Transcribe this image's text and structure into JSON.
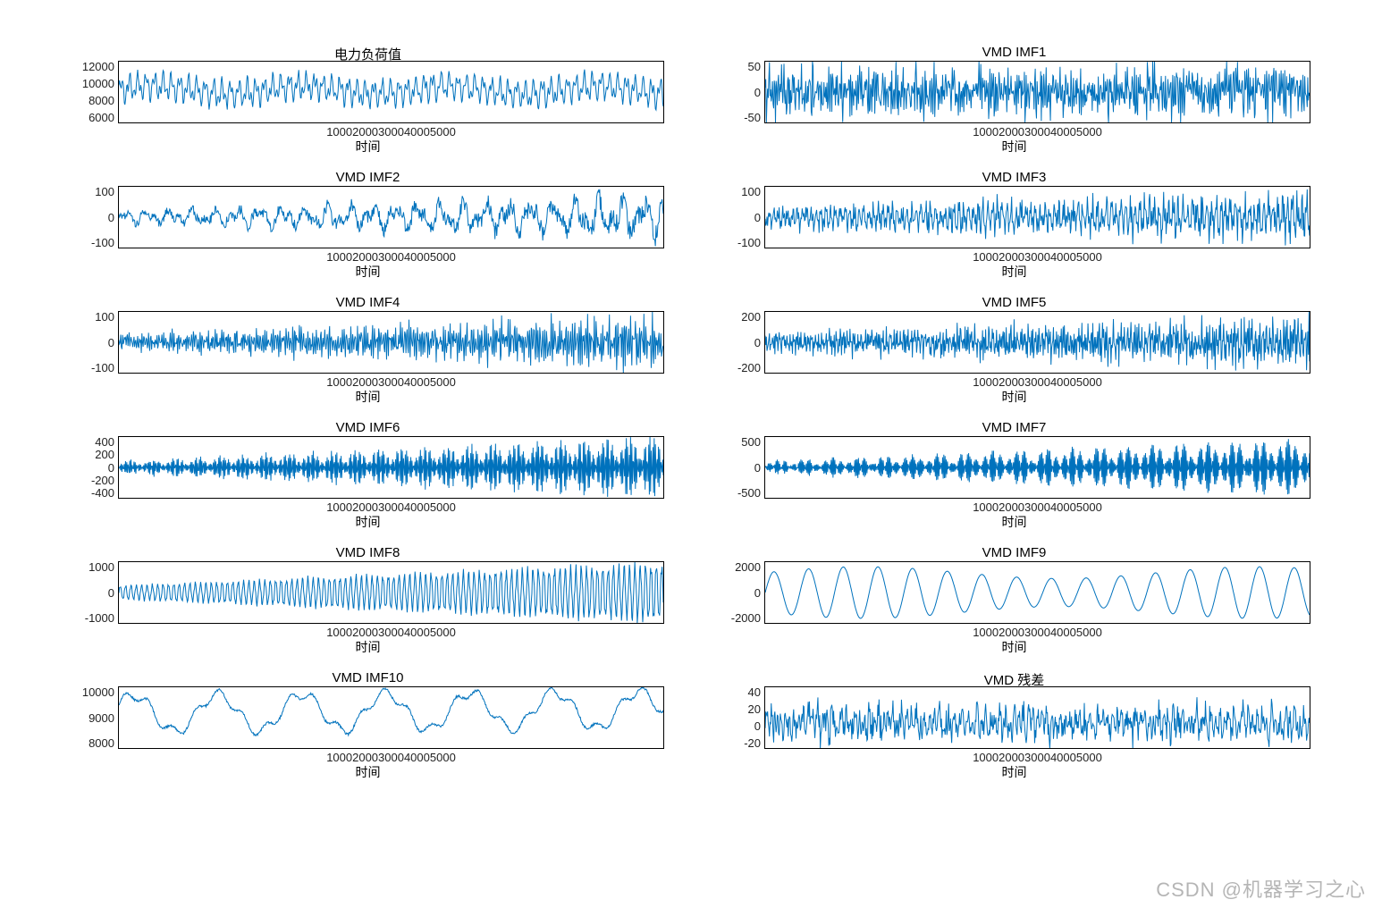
{
  "watermark": "CSDN @机器学习之心",
  "xlabel": "时间",
  "xticks": [
    "1000",
    "2000",
    "3000",
    "4000",
    "5000"
  ],
  "chart_data": [
    {
      "id": "orig",
      "title": "电力负荷值",
      "type": "line",
      "yticks": [
        "6000",
        "8000",
        "10000",
        "12000"
      ],
      "ylim": [
        6000,
        12000
      ],
      "xlim": [
        0,
        5800
      ],
      "xlabel": "时间",
      "style": "load",
      "params": {
        "base": 9200,
        "amp": 2600,
        "noise": 500,
        "freq": 0.07
      }
    },
    {
      "id": "imf1",
      "title": "VMD IMF1",
      "type": "line",
      "yticks": [
        "-50",
        "0",
        "50"
      ],
      "ylim": [
        -70,
        70
      ],
      "xlim": [
        0,
        5800
      ],
      "xlabel": "时间",
      "style": "noise",
      "params": {
        "amp": 55,
        "freq": 1.3
      }
    },
    {
      "id": "imf2",
      "title": "VMD IMF2",
      "type": "line",
      "yticks": [
        "-100",
        "0",
        "100"
      ],
      "ylim": [
        -140,
        140
      ],
      "xlim": [
        0,
        5800
      ],
      "xlabel": "时间",
      "style": "grownoise",
      "params": {
        "amp0": 35,
        "amp1": 110,
        "freq": 1.0
      }
    },
    {
      "id": "imf3",
      "title": "VMD IMF3",
      "type": "line",
      "yticks": [
        "-100",
        "0",
        "100"
      ],
      "ylim": [
        -140,
        140
      ],
      "xlim": [
        0,
        5800
      ],
      "xlabel": "时间",
      "style": "grownoise",
      "params": {
        "amp0": 60,
        "amp1": 115,
        "freq": 0.85
      }
    },
    {
      "id": "imf4",
      "title": "VMD IMF4",
      "type": "line",
      "yticks": [
        "-100",
        "0",
        "100"
      ],
      "ylim": [
        -160,
        160
      ],
      "xlim": [
        0,
        5800
      ],
      "xlabel": "时间",
      "style": "grownoise",
      "params": {
        "amp0": 50,
        "amp1": 140,
        "freq": 0.7
      }
    },
    {
      "id": "imf5",
      "title": "VMD IMF5",
      "type": "line",
      "yticks": [
        "-200",
        "0",
        "200"
      ],
      "ylim": [
        -220,
        220
      ],
      "xlim": [
        0,
        5800
      ],
      "xlabel": "时间",
      "style": "grownoise",
      "params": {
        "amp0": 80,
        "amp1": 190,
        "freq": 0.6
      }
    },
    {
      "id": "imf6",
      "title": "VMD IMF6",
      "type": "line",
      "yticks": [
        "-400",
        "-200",
        "0",
        "200",
        "400"
      ],
      "ylim": [
        -420,
        420
      ],
      "xlim": [
        0,
        5800
      ],
      "xlabel": "时间",
      "style": "beat",
      "params": {
        "carrier": 0.55,
        "env": 0.013,
        "amp": 360,
        "grow": 1
      }
    },
    {
      "id": "imf7",
      "title": "VMD IMF7",
      "type": "line",
      "yticks": [
        "-500",
        "0",
        "500"
      ],
      "ylim": [
        -600,
        600
      ],
      "xlim": [
        0,
        5800
      ],
      "xlabel": "时间",
      "style": "beat",
      "params": {
        "carrier": 0.45,
        "env": 0.011,
        "amp": 480,
        "grow": 1
      }
    },
    {
      "id": "imf8",
      "title": "VMD IMF8",
      "type": "line",
      "yticks": [
        "-1000",
        "0",
        "1000"
      ],
      "ylim": [
        -1200,
        1200
      ],
      "xlim": [
        0,
        5800
      ],
      "xlabel": "时间",
      "style": "growosc",
      "params": {
        "amp0": 250,
        "amp1": 1050,
        "freq": 0.11
      }
    },
    {
      "id": "imf9",
      "title": "VMD IMF9",
      "type": "line",
      "yticks": [
        "-2000",
        "0",
        "2000"
      ],
      "ylim": [
        -2200,
        2200
      ],
      "xlim": [
        0,
        5800
      ],
      "xlabel": "时间",
      "style": "osc",
      "params": {
        "amp": 1700,
        "freq": 0.017
      }
    },
    {
      "id": "imf10",
      "title": "VMD IMF10",
      "type": "line",
      "yticks": [
        "8000",
        "9000",
        "10000"
      ],
      "ylim": [
        7200,
        10200
      ],
      "xlim": [
        0,
        5800
      ],
      "xlabel": "时间",
      "style": "trend",
      "params": {
        "base": 8900,
        "amp": 900,
        "freq": 0.007,
        "amp2": 250,
        "freq2": 0.025
      }
    },
    {
      "id": "res",
      "title": "VMD 残差",
      "type": "line",
      "yticks": [
        "-20",
        "0",
        "20",
        "40"
      ],
      "ylim": [
        -35,
        50
      ],
      "xlim": [
        0,
        5800
      ],
      "xlabel": "时间",
      "style": "noise",
      "params": {
        "amp": 25,
        "freq": 1.1
      }
    }
  ]
}
